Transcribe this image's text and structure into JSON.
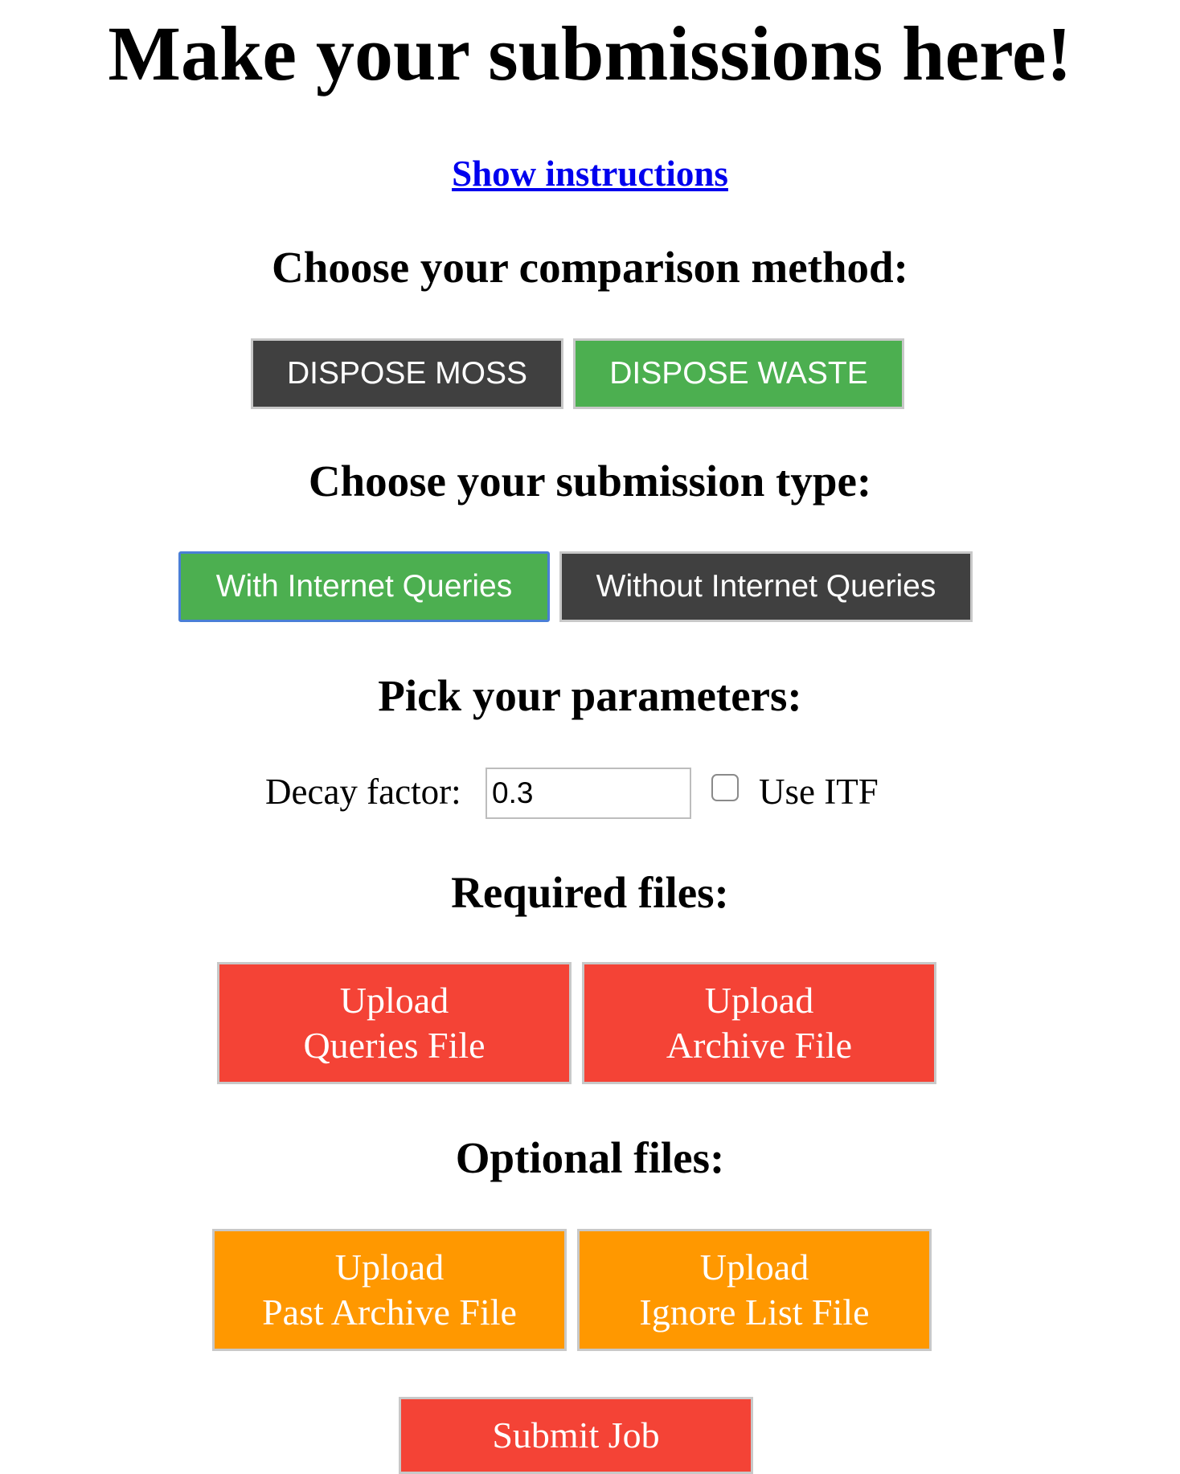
{
  "title": "Make your submissions here!",
  "instructions_link": "Show instructions",
  "comparison": {
    "heading": "Choose your comparison method:",
    "options": [
      "DISPOSE MOSS",
      "DISPOSE WASTE"
    ],
    "selected": "DISPOSE WASTE"
  },
  "submission_type": {
    "heading": "Choose your submission type:",
    "options": [
      "With Internet Queries",
      "Without Internet Queries"
    ],
    "selected": "With Internet Queries"
  },
  "parameters": {
    "heading": "Pick your parameters:",
    "decay_label": "Decay factor:",
    "decay_value": "0.3",
    "use_itf_label": "Use ITF",
    "use_itf_checked": false
  },
  "required_files": {
    "heading": "Required files:",
    "queries": {
      "line1": "Upload",
      "line2": "Queries File"
    },
    "archive": {
      "line1": "Upload",
      "line2": "Archive File"
    }
  },
  "optional_files": {
    "heading": "Optional files:",
    "past_archive": {
      "line1": "Upload",
      "line2": "Past Archive File"
    },
    "ignore_list": {
      "line1": "Upload",
      "line2": "Ignore List File"
    }
  },
  "submit_label": "Submit Job",
  "colors": {
    "dark_button": "#404040",
    "selected_button": "#4caf50",
    "required_button": "#f44336",
    "optional_button": "#ff9800",
    "link": "#0000ee",
    "focus_ring": "#4a7fd6"
  }
}
